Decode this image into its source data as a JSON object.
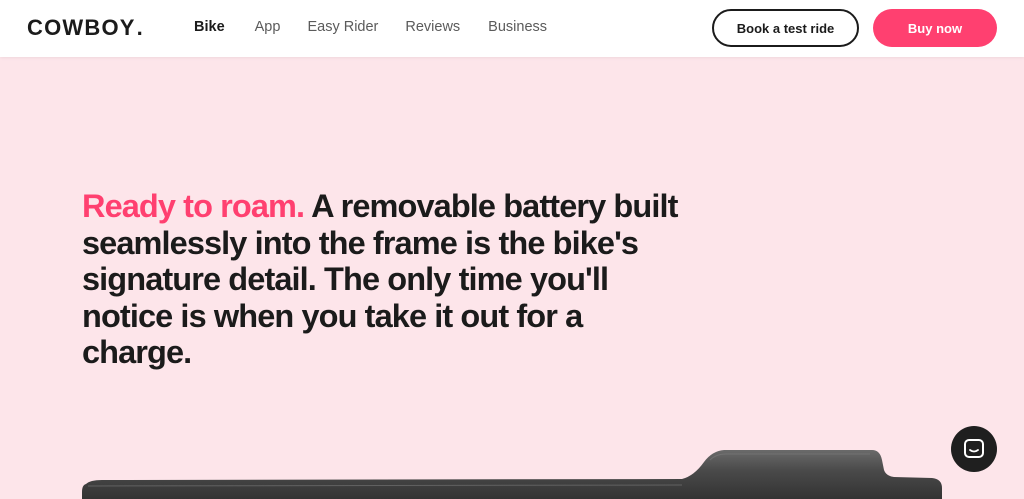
{
  "header": {
    "logo_text": "COWBOY",
    "logo_dot": ".",
    "nav": [
      {
        "label": "Bike",
        "active": true
      },
      {
        "label": "App",
        "active": false
      },
      {
        "label": "Easy Rider",
        "active": false
      },
      {
        "label": "Reviews",
        "active": false
      },
      {
        "label": "Business",
        "active": false
      }
    ],
    "book_test_ride_label": "Book a test ride",
    "buy_now_label": "Buy now"
  },
  "hero": {
    "accent_text": "Ready to roam.",
    "body_text": "A removable battery built seamlessly into the frame is the bike's signature detail. The only time you'll notice is when you take it out for a charge."
  },
  "colors": {
    "accent": "#ff4070",
    "background": "#fde5ea",
    "text": "#1b1b1b"
  },
  "icons": {
    "chat": "chat-bubble-icon",
    "battery_image": "battery-image"
  }
}
